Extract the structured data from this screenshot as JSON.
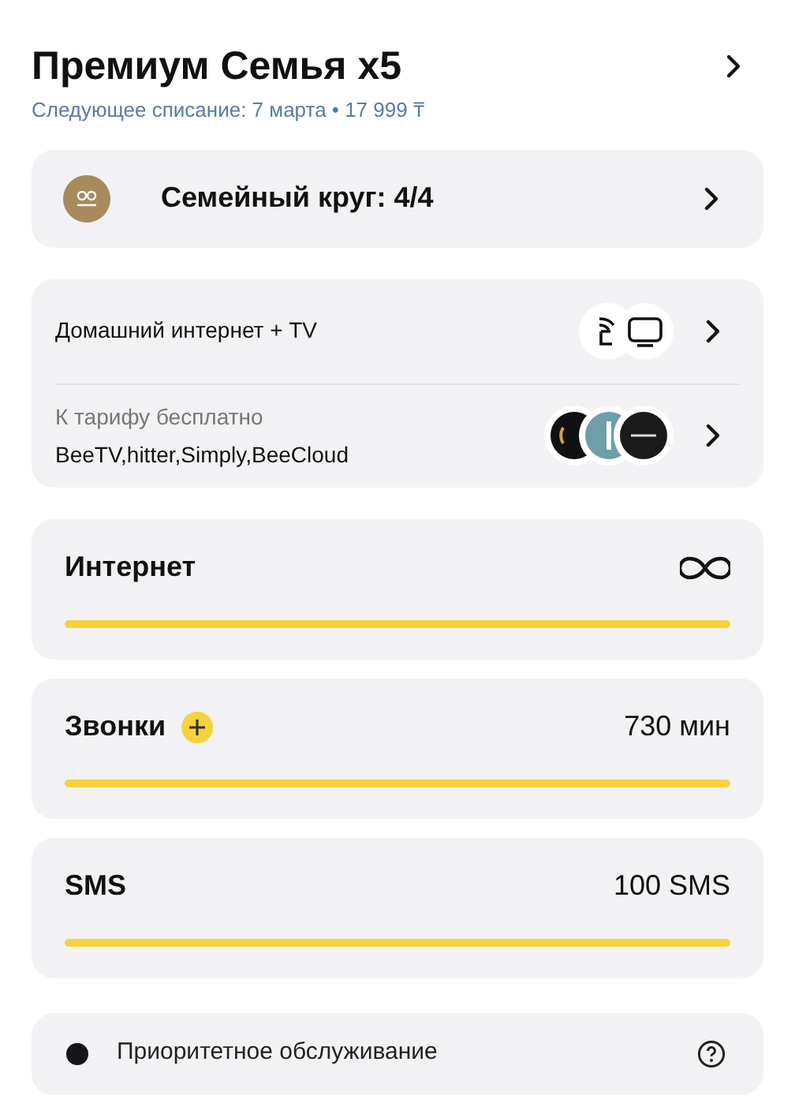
{
  "header": {
    "title": "Премиум Семья x5",
    "subtitle": "Следующее списание: 7 марта • 17 999 ₸"
  },
  "family": {
    "label": "Семейный круг: 4/4"
  },
  "services": [
    {
      "kind": "home",
      "label": "Домашний интернет + TV"
    },
    {
      "kind": "free",
      "caption": "К тарифу бесплатно",
      "label": "BeeTV,hitter,Simply,BeeCloud"
    }
  ],
  "meters": [
    {
      "kind": "unlimited",
      "name": "Интернет",
      "level": 1
    },
    {
      "kind": "plus",
      "name": "Звонки",
      "reading": "730 мин",
      "level": 1
    },
    {
      "kind": "plain",
      "name": "SMS",
      "reading": "100 SMS",
      "level": 1
    }
  ],
  "priority": {
    "label": "Приоритетное обслуживание"
  }
}
